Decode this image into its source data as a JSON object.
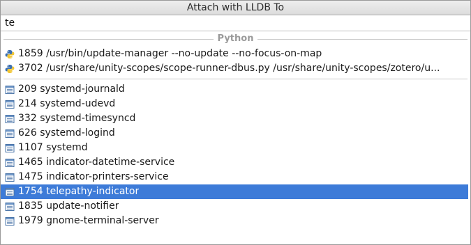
{
  "dialog": {
    "title": "Attach with LLDB To"
  },
  "search": {
    "value": "te"
  },
  "groups": {
    "python_label": "Python"
  },
  "python_processes": [
    {
      "pid": "1859",
      "command": "/usr/bin/update-manager --no-update --no-focus-on-map",
      "icon": "python-icon"
    },
    {
      "pid": "3702",
      "command": "/usr/share/unity-scopes/scope-runner-dbus.py /usr/share/unity-scopes/zotero/u...",
      "icon": "python-icon"
    }
  ],
  "processes": [
    {
      "pid": "209",
      "command": "systemd-journald",
      "icon": "process-icon"
    },
    {
      "pid": "214",
      "command": "systemd-udevd",
      "icon": "process-icon"
    },
    {
      "pid": "332",
      "command": "systemd-timesyncd",
      "icon": "process-icon"
    },
    {
      "pid": "626",
      "command": "systemd-logind",
      "icon": "process-icon"
    },
    {
      "pid": "1107",
      "command": "systemd",
      "icon": "process-icon"
    },
    {
      "pid": "1465",
      "command": "indicator-datetime-service",
      "icon": "process-icon"
    },
    {
      "pid": "1475",
      "command": "indicator-printers-service",
      "icon": "process-icon"
    },
    {
      "pid": "1754",
      "command": "telepathy-indicator",
      "icon": "process-icon",
      "selected": true
    },
    {
      "pid": "1835",
      "command": "update-notifier",
      "icon": "process-icon"
    },
    {
      "pid": "1979",
      "command": "gnome-terminal-server",
      "icon": "process-icon"
    }
  ],
  "colors": {
    "selection": "#3d7bd8",
    "group_label": "#9a9a9a",
    "python_blue": "#3a6fb0",
    "python_yellow": "#f2c531"
  }
}
